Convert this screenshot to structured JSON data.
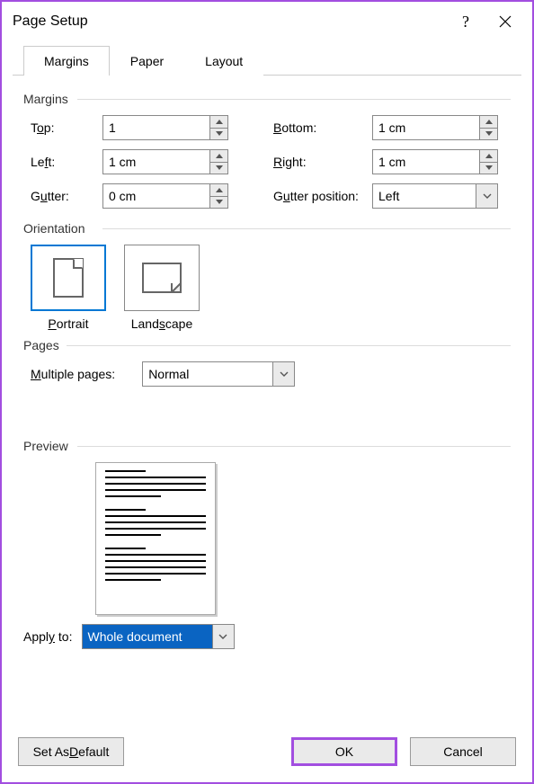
{
  "title": "Page Setup",
  "tabs": {
    "margins": "Margins",
    "paper": "Paper",
    "layout": "Layout"
  },
  "groups": {
    "margins": "Margins",
    "orientation": "Orientation",
    "pages": "Pages",
    "preview": "Preview"
  },
  "margins": {
    "top_label_pre": "T",
    "top_label_u": "o",
    "top_label_post": "p:",
    "top_value": "1",
    "bottom_label_u": "B",
    "bottom_label_post": "ottom:",
    "bottom_value": "1 cm",
    "left_label_pre": "Le",
    "left_label_u": "f",
    "left_label_post": "t:",
    "left_value": "1 cm",
    "right_label_u": "R",
    "right_label_post": "ight:",
    "right_value": "1 cm",
    "gutter_label_pre": "G",
    "gutter_label_u": "u",
    "gutter_label_post": "tter:",
    "gutter_value": "0 cm",
    "gutterpos_label_pre": "G",
    "gutterpos_label_u": "u",
    "gutterpos_label_post": "tter position:",
    "gutterpos_value": "Left"
  },
  "orientation": {
    "portrait_u": "P",
    "portrait_post": "ortrait",
    "landscape_pre": "Land",
    "landscape_u": "s",
    "landscape_post": "cape"
  },
  "pages": {
    "multi_u": "M",
    "multi_post": "ultiple pages:",
    "multi_value": "Normal"
  },
  "apply": {
    "label_pre": "Appl",
    "label_u": "y",
    "label_post": " to:",
    "value": "Whole document"
  },
  "buttons": {
    "default_pre": "Set As ",
    "default_u": "D",
    "default_post": "efault",
    "ok": "OK",
    "cancel": "Cancel"
  }
}
